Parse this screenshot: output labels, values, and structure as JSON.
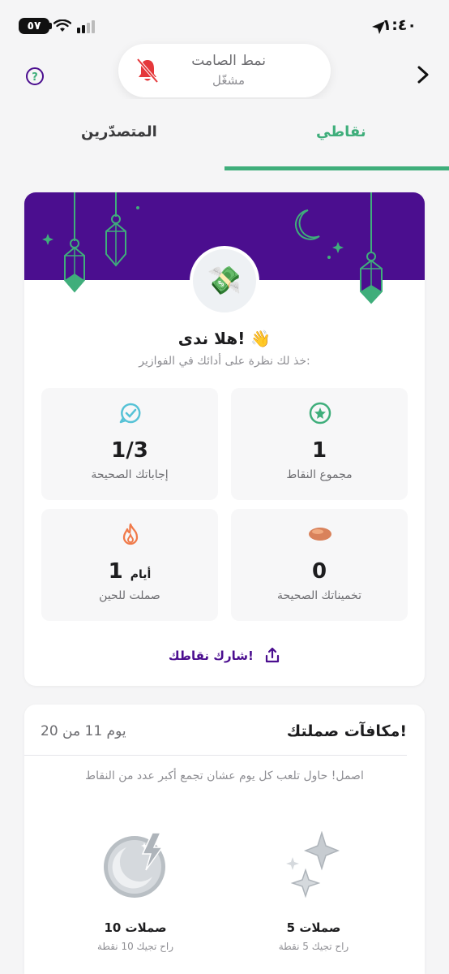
{
  "status_bar": {
    "time": "١:٤٠",
    "battery": "٥٧"
  },
  "silent_mode": {
    "title": "نمط الصامت",
    "subtitle": "مشغّل"
  },
  "tabs": [
    {
      "label": "نقاطي",
      "active": true
    },
    {
      "label": "المتصدّرين",
      "active": false
    }
  ],
  "profile": {
    "greeting": "هلا ندى! 👋",
    "subtitle": "خذ لك نظرة على أدائك في الفوازير:"
  },
  "stats": {
    "total_points": {
      "value": "1",
      "label": "مجموع النقاط"
    },
    "correct_answers": {
      "value": "1/3",
      "label": "إجاباتك الصحيحة"
    },
    "correct_guesses": {
      "value": "0",
      "label": "تخميناتك الصحيحة"
    },
    "streak": {
      "value": "1",
      "unit": "أيام",
      "label": "صملت للحين"
    }
  },
  "share_label": "شارك نقاطك!",
  "rewards": {
    "title": "مكافآت صملتك!",
    "day_progress": "يوم 11 من 20",
    "hint": "اصمل! حاول تلعب كل يوم عشان تجمع أكبر عدد من النقاط",
    "items": [
      {
        "title": "5 صملات",
        "subtitle": "راح تجيك 5 نقطة"
      },
      {
        "title": "10 صملات",
        "subtitle": "راح تجيك 10 نقطة"
      }
    ]
  },
  "colors": {
    "accent_green": "#3fae7b",
    "banner_purple": "#4b0e8f",
    "bell_red": "#e5383b",
    "flame_orange": "#f07a4a"
  }
}
